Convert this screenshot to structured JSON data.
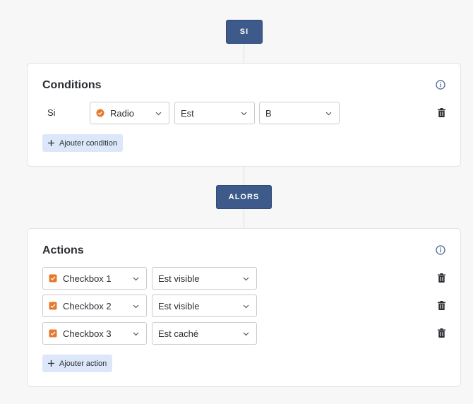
{
  "steps": {
    "si_label": "SI",
    "alors_label": "ALORS"
  },
  "conditions": {
    "title": "Conditions",
    "row": {
      "prefix": "Si",
      "field": {
        "label": "Radio",
        "icon": "radio-icon"
      },
      "operator": "Est",
      "value": "B"
    },
    "add_label": "Ajouter condition"
  },
  "actions": {
    "title": "Actions",
    "rows": [
      {
        "field": "Checkbox 1",
        "icon": "checkbox-icon",
        "state": "Est visible"
      },
      {
        "field": "Checkbox 2",
        "icon": "checkbox-icon",
        "state": "Est visible"
      },
      {
        "field": "Checkbox 3",
        "icon": "checkbox-icon",
        "state": "Est caché"
      }
    ],
    "add_label": "Ajouter action"
  },
  "colors": {
    "step_badge": "#3d5a8a",
    "add_button_bg": "#dce8f9",
    "field_icon": "#e8782c",
    "page_bg": "#f7f7f8"
  }
}
